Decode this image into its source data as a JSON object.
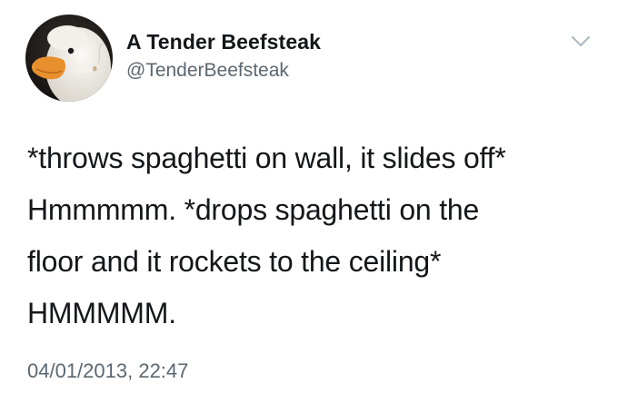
{
  "author": {
    "display_name": "A Tender Beefsteak",
    "handle": "@TenderBeefsteak",
    "avatar_icon": "duck-with-cigarette-avatar"
  },
  "tweet": {
    "lines": [
      "*throws spaghetti on wall, it slides off*",
      "Hmmmmm. *drops spaghetti on the",
      "floor and it rockets to the ceiling*",
      "HMMMMM."
    ],
    "timestamp": "04/01/2013, 22:47"
  },
  "menu": {
    "icon": "chevron-down-icon"
  },
  "colors": {
    "text_primary": "#14171a",
    "text_secondary": "#5b6770",
    "chevron": "#aab8c2",
    "background": "#ffffff"
  }
}
